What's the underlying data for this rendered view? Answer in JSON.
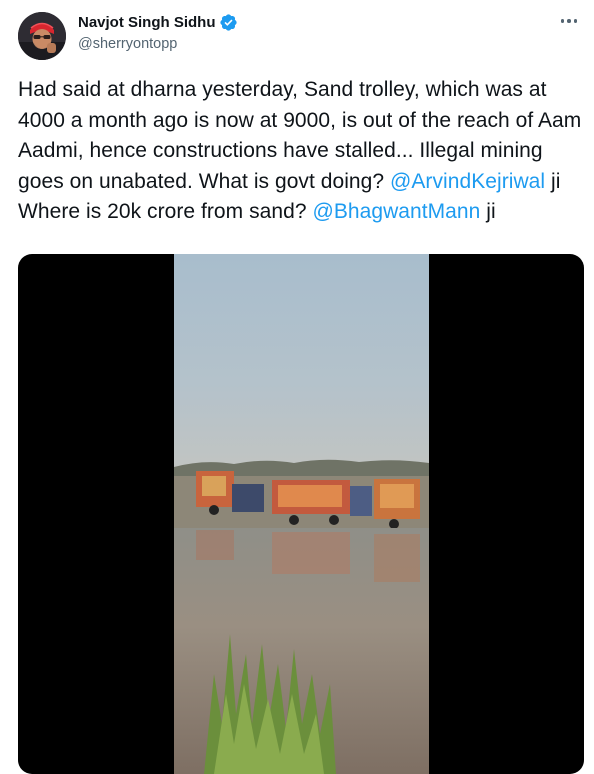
{
  "author": {
    "display_name": "Navjot Singh Sidhu",
    "handle": "@sherryontopp",
    "verified": true,
    "avatar_icon": "avatar-photo"
  },
  "tweet": {
    "text_parts": [
      {
        "text": "Had said at dharna yesterday, Sand trolley, which was at 4000 a month ago is now at 9000, is out of the reach of Aam Aadmi, hence constructions  have stalled... Illegal mining goes on unabated. What is govt doing? "
      },
      {
        "text": "@ArvindKejriwal",
        "mention": true
      },
      {
        "text": " ji Where is 20k crore from sand? "
      },
      {
        "text": "@BhagwantMann",
        "mention": true
      },
      {
        "text": " ji"
      }
    ]
  },
  "media": {
    "type": "video",
    "description_icon": "video-thumbnail"
  },
  "icons": {
    "more": "more-options-icon",
    "verified": "verified-badge-icon"
  },
  "colors": {
    "accent": "#1d9bf0",
    "text": "#0f1419",
    "secondary_text": "#536471",
    "media_background": "#000000"
  }
}
